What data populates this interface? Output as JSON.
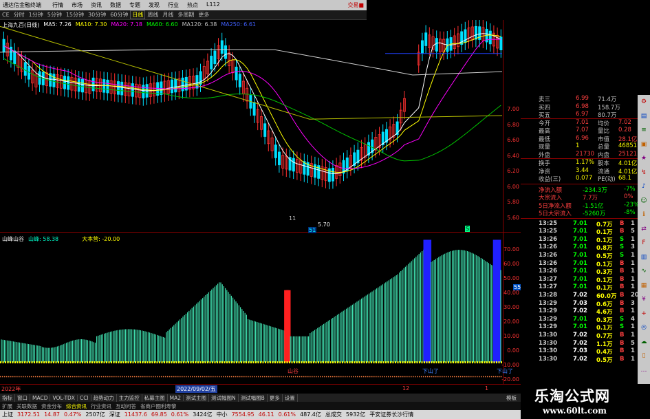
{
  "app": {
    "title": "通达信金融终端",
    "menu": [
      "行情",
      "市场",
      "资讯",
      "数据",
      "专题",
      "发现",
      "行业",
      "热点",
      "L112"
    ],
    "menu_right": "交易■"
  },
  "periods": [
    "CE",
    "分时",
    "1分钟",
    "5分钟",
    "15分钟",
    "30分钟",
    "60分钟",
    "日线",
    "周线",
    "月线",
    "多周期",
    "更多"
  ],
  "main": {
    "stock_name": "上海九百(日线)",
    "ma": [
      {
        "label": "MA5: 7.26",
        "color": "#ffffff"
      },
      {
        "label": "MA10: 7.30",
        "color": "#ffff00"
      },
      {
        "label": "MA20: 7.18",
        "color": "#ff00ff"
      },
      {
        "label": "MA60: 6.60",
        "color": "#00ff00"
      },
      {
        "label": "MA120: 6.38",
        "color": "#c0c0c0"
      },
      {
        "label": "MA250: 6.61",
        "color": "#4060ff"
      }
    ],
    "y_labels": [
      "7.00",
      "6.80",
      "6.60",
      "6.40",
      "6.20",
      "6.00",
      "5.80",
      "5.60"
    ],
    "low_marker": "5.70",
    "ann_marks": [
      "11",
      "51",
      "S"
    ]
  },
  "indicator": {
    "name": "山峰山谷",
    "line_label": "山峰: 58.38",
    "second_label": "大本营: -20.00",
    "y_labels": [
      "70.00",
      "60.00",
      "50.00",
      "40.00",
      "30.00",
      "20.00",
      "10.00",
      "0.00",
      "-10.00",
      "-20.00"
    ],
    "current_value": "55.25",
    "signals": [
      "山谷",
      "下山了",
      "下山了"
    ]
  },
  "date_axis": {
    "start": "2022年",
    "cursor": "2022/09/02/五",
    "labels": [
      "12",
      "1"
    ]
  },
  "tabs": [
    "指标",
    "窗口",
    "MACD",
    "VOL-TDX",
    "CCI",
    "趋势动力",
    "主力监控",
    "私募主图",
    "MA2",
    "测试主图",
    "测试幅图N",
    "测试幅图B",
    "更多",
    "设置"
  ],
  "tab_right": "模板",
  "nav": [
    {
      "t": "扩展",
      "hl": false
    },
    {
      "t": "关联数据",
      "hl": false
    },
    {
      "t": "资金分布",
      "hl": false
    },
    {
      "t": "综合资讯",
      "hl": true
    },
    {
      "t": "行业资讯",
      "hl": false
    },
    {
      "t": "互动问答",
      "hl": false
    },
    {
      "t": "省商户圈利寿黎",
      "hl": false
    }
  ],
  "status": [
    {
      "t": "上证",
      "c": "k"
    },
    {
      "t": "3172.51",
      "c": "r"
    },
    {
      "t": "14.87",
      "c": "r"
    },
    {
      "t": "0.47%",
      "c": "r"
    },
    {
      "t": "2507亿",
      "c": "k"
    },
    {
      "t": "深证",
      "c": "k"
    },
    {
      "t": "11437.6",
      "c": "r"
    },
    {
      "t": "69.85",
      "c": "r"
    },
    {
      "t": "0.61%",
      "c": "r"
    },
    {
      "t": "3424亿",
      "c": "k"
    },
    {
      "t": "中小",
      "c": "k"
    },
    {
      "t": "7554.95",
      "c": "r"
    },
    {
      "t": "46.11",
      "c": "r"
    },
    {
      "t": "0.61%",
      "c": "r"
    },
    {
      "t": "487.4亿",
      "c": "k"
    },
    {
      "t": "总成交",
      "c": "k"
    },
    {
      "t": "5932亿",
      "c": "k"
    },
    {
      "t": "平安证券长沙行情",
      "c": "k"
    }
  ],
  "quote": {
    "rows": [
      {
        "a": "卖三",
        "b": "6.99",
        "c": "71.4万",
        "d": "",
        "col": "#ff4040"
      },
      {
        "a": "买四",
        "b": "6.98",
        "c": "158.7万",
        "d": "",
        "col": "#ff4040"
      },
      {
        "a": "买五",
        "b": "6.97",
        "c": "80.7万",
        "d": "",
        "col": "#ff4040"
      },
      {
        "a": "今开",
        "b": "7.01",
        "c": "均价",
        "d": "7.02",
        "col": "#ff4040"
      },
      {
        "a": "最高",
        "b": "7.07",
        "c": "量比",
        "d": "0.28",
        "col": "#ff4040"
      },
      {
        "a": "最低",
        "b": "6.96",
        "c": "市值",
        "d": "28.1亿",
        "col": "#ff4040"
      },
      {
        "a": "现量",
        "b": "1",
        "c": "总量",
        "d": "46851",
        "col": "#ffff00"
      },
      {
        "a": "外盘",
        "b": "21730",
        "c": "内盘",
        "d": "25121",
        "col": "#ff4040"
      },
      {
        "a": "换手",
        "b": "1.17%",
        "c": "股本",
        "d": "4.01亿",
        "col": "#ffff00"
      },
      {
        "a": "净资",
        "b": "3.44",
        "c": "流通",
        "d": "4.01亿",
        "col": "#ffff00"
      },
      {
        "a": "收益(三)",
        "b": "0.077",
        "c": "PE(动)",
        "d": "68.1",
        "col": "#ffff00"
      }
    ],
    "flow": [
      {
        "a": "净流入额",
        "b": "-234.3万",
        "c": "-7%",
        "col": "#00ff00"
      },
      {
        "a": "大宗流入",
        "b": "7.7万",
        "c": "0%",
        "col": "#ff4040"
      },
      {
        "a": "5日净流入额",
        "b": "-1.51亿",
        "c": "-23%",
        "col": "#00ff00"
      },
      {
        "a": "5日大宗流入",
        "b": "-5260万",
        "c": "-8%",
        "col": "#00ff00"
      }
    ]
  },
  "ticks": [
    {
      "t": "13:25",
      "p": "7.01",
      "v": "0.7万",
      "s": "B",
      "n": "1"
    },
    {
      "t": "13:25",
      "p": "7.01",
      "v": "0.1万",
      "s": "B",
      "n": "5"
    },
    {
      "t": "13:26",
      "p": "7.01",
      "v": "0.1万",
      "s": "S",
      "n": "1"
    },
    {
      "t": "13:26",
      "p": "7.01",
      "v": "0.8万",
      "s": "S",
      "n": "3"
    },
    {
      "t": "13:26",
      "p": "7.01",
      "v": "0.5万",
      "s": "S",
      "n": "1"
    },
    {
      "t": "13:26",
      "p": "7.01",
      "v": "0.1万",
      "s": "B",
      "n": "1"
    },
    {
      "t": "13:26",
      "p": "7.01",
      "v": "0.3万",
      "s": "B",
      "n": "1"
    },
    {
      "t": "13:27",
      "p": "7.01",
      "v": "0.1万",
      "s": "B",
      "n": "1"
    },
    {
      "t": "13:27",
      "p": "7.01",
      "v": "0.1万",
      "s": "B",
      "n": "1"
    },
    {
      "t": "13:28",
      "p": "7.02",
      "v": "60.0万",
      "s": "B",
      "n": "20"
    },
    {
      "t": "13:29",
      "p": "7.03",
      "v": "0.6万",
      "s": "B",
      "n": "3"
    },
    {
      "t": "13:29",
      "p": "7.02",
      "v": "4.6万",
      "s": "B",
      "n": "1"
    },
    {
      "t": "13:29",
      "p": "7.01",
      "v": "0.3万",
      "s": "S",
      "n": "4"
    },
    {
      "t": "13:29",
      "p": "7.01",
      "v": "0.1万",
      "s": "S",
      "n": "1"
    },
    {
      "t": "13:30",
      "p": "7.02",
      "v": "0.7万",
      "s": "B",
      "n": "1"
    },
    {
      "t": "13:30",
      "p": "7.02",
      "v": "1.1万",
      "s": "B",
      "n": "5"
    },
    {
      "t": "13:30",
      "p": "7.03",
      "v": "0.4万",
      "s": "B",
      "n": "1"
    },
    {
      "t": "13:30",
      "p": "7.02",
      "v": "0.5万",
      "s": "B",
      "n": "1"
    }
  ],
  "sidebar_icons": [
    "gear-icon",
    "chart-icon",
    "list-icon",
    "news-icon",
    "star-icon",
    "flow-icon",
    "bell-icon",
    "user-icon",
    "info-icon",
    "swap-icon",
    "F10",
    "bars-icon",
    "line-icon",
    "grid-icon",
    "money-icon",
    "plus-icon",
    "globe-icon",
    "cloud-icon",
    "doc-icon",
    "more-icon"
  ],
  "watermark": {
    "line1": "乐淘公式网",
    "line2": "www.60lt.com"
  }
}
